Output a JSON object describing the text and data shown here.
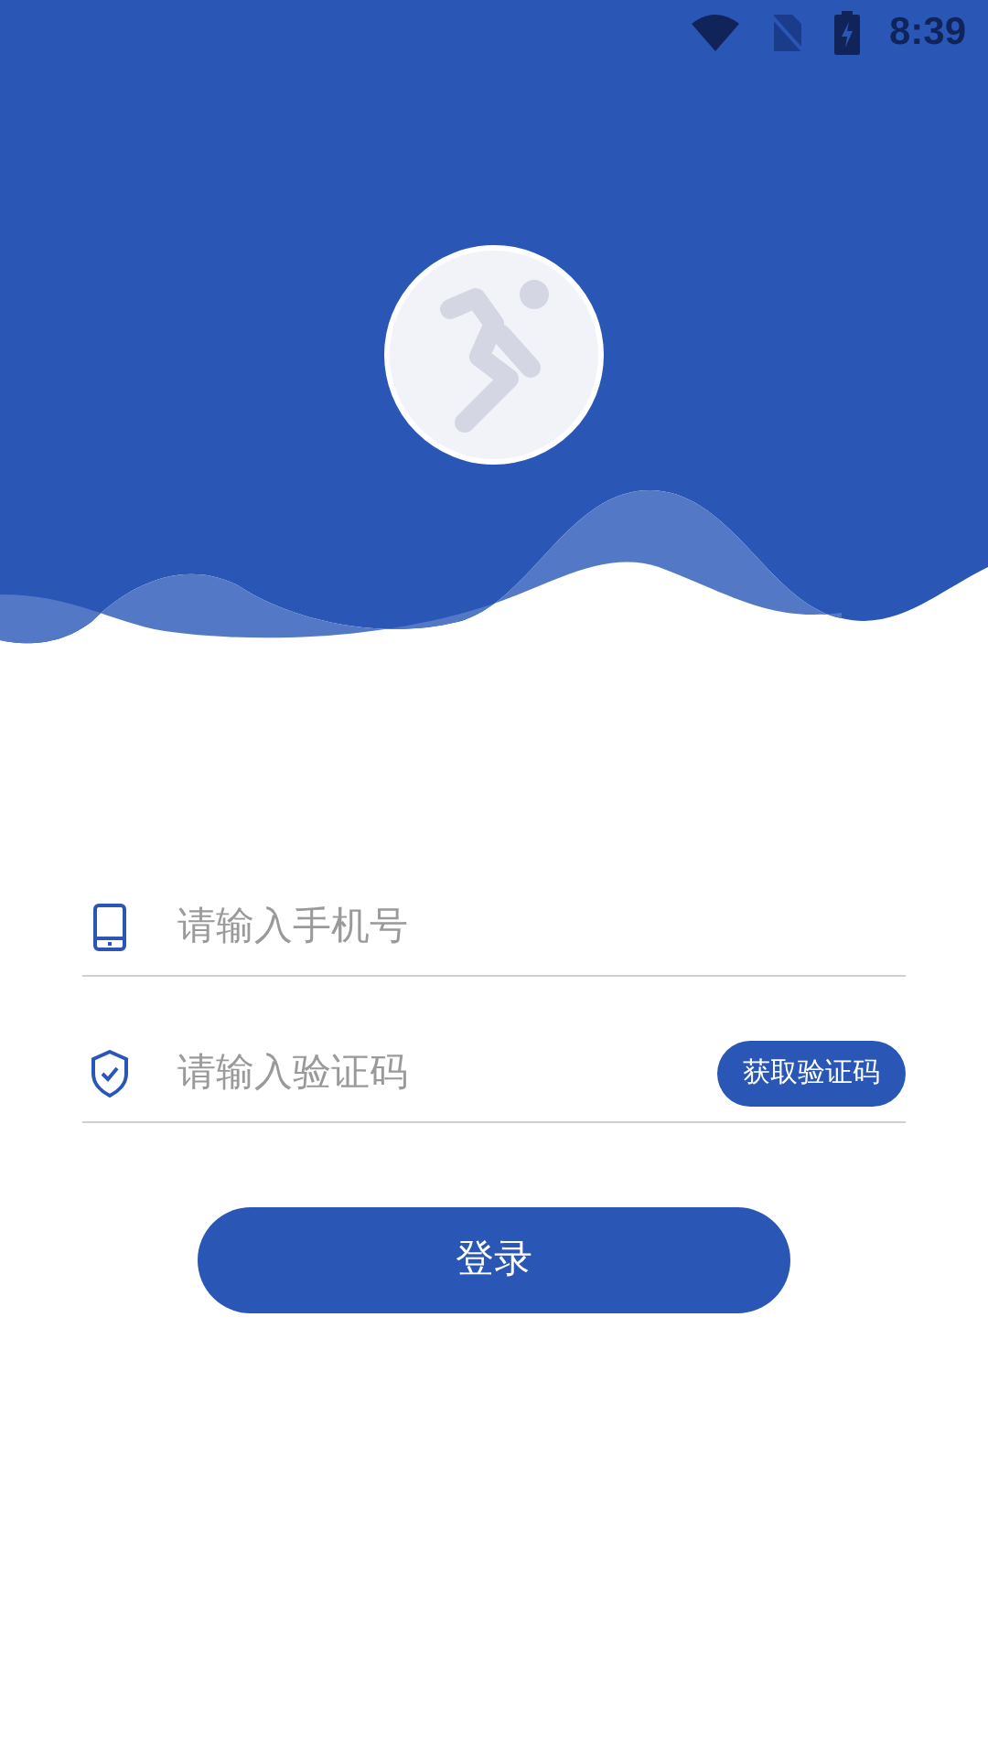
{
  "status_bar": {
    "time": "8:39"
  },
  "fields": [
    {
      "kind": "phone",
      "placeholder": "请输入手机号"
    },
    {
      "kind": "code",
      "placeholder": "请输入验证码",
      "action": "获取验证码"
    }
  ],
  "login_button": "登录"
}
